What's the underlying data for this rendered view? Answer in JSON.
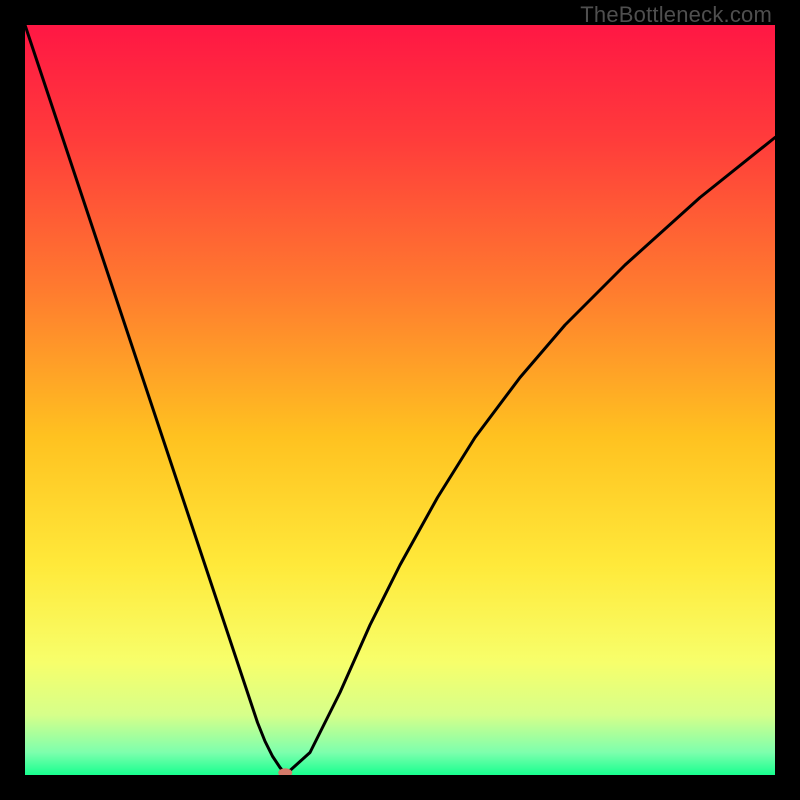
{
  "watermark": "TheBottleneck.com",
  "chart_data": {
    "type": "line",
    "title": "",
    "xlabel": "",
    "ylabel": "",
    "xlim": [
      0,
      100
    ],
    "ylim": [
      0,
      100
    ],
    "legend": false,
    "grid": false,
    "background_gradient": {
      "orientation": "vertical",
      "stops": [
        {
          "offset": 0.0,
          "color": "#ff1744"
        },
        {
          "offset": 0.15,
          "color": "#ff3b3b"
        },
        {
          "offset": 0.35,
          "color": "#ff7a2f"
        },
        {
          "offset": 0.55,
          "color": "#ffc220"
        },
        {
          "offset": 0.72,
          "color": "#ffe93a"
        },
        {
          "offset": 0.85,
          "color": "#f7ff6b"
        },
        {
          "offset": 0.92,
          "color": "#d6ff8a"
        },
        {
          "offset": 0.97,
          "color": "#7dffad"
        },
        {
          "offset": 1.0,
          "color": "#18ff8f"
        }
      ]
    },
    "series": [
      {
        "name": "bottleneck-curve",
        "x": [
          0,
          2,
          4,
          6,
          8,
          10,
          12,
          14,
          16,
          18,
          20,
          22,
          24,
          26,
          28,
          30,
          31,
          32,
          33,
          34,
          34.5,
          35,
          38,
          42,
          46,
          50,
          55,
          60,
          66,
          72,
          80,
          90,
          100
        ],
        "values": [
          100,
          94,
          88,
          82,
          76,
          70,
          64,
          58,
          52,
          46,
          40,
          34,
          28,
          22,
          16,
          10,
          7,
          4.5,
          2.5,
          1.0,
          0.4,
          0.3,
          3,
          11,
          20,
          28,
          37,
          45,
          53,
          60,
          68,
          77,
          85
        ]
      }
    ],
    "marker": {
      "x": 34.7,
      "y": 0.3,
      "color": "#d47a6a",
      "rx": 7,
      "ry": 4.5
    }
  }
}
